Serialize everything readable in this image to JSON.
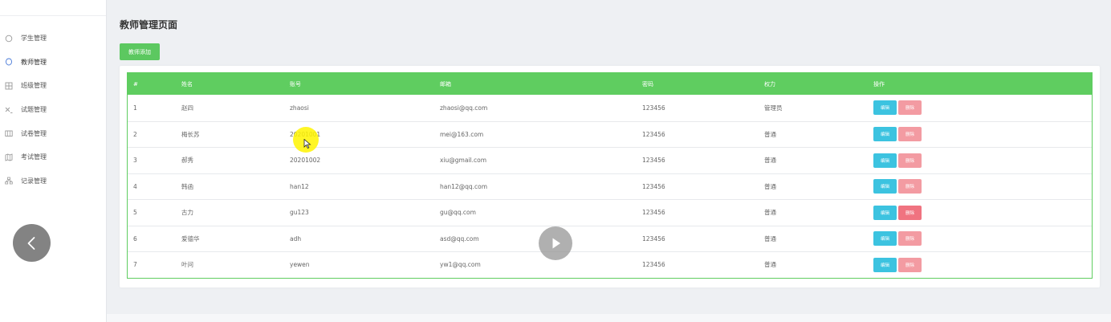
{
  "sidebar": {
    "items": [
      {
        "label": "学生管理",
        "icon": "student-icon"
      },
      {
        "label": "教师管理",
        "icon": "teacher-icon"
      },
      {
        "label": "班级管理",
        "icon": "class-icon"
      },
      {
        "label": "试题管理",
        "icon": "question-icon"
      },
      {
        "label": "试卷管理",
        "icon": "paper-icon"
      },
      {
        "label": "考试管理",
        "icon": "exam-icon"
      },
      {
        "label": "记录管理",
        "icon": "record-icon"
      }
    ],
    "active_index": 1
  },
  "page": {
    "title": "教师管理页面",
    "add_button": "教师添加"
  },
  "table": {
    "headers": [
      "#",
      "姓名",
      "账号",
      "邮箱",
      "密码",
      "权力",
      "操作"
    ],
    "rows": [
      {
        "id": "1",
        "name": "赵四",
        "account": "zhaosi",
        "email": "zhaosi@qq.com",
        "password": "123456",
        "role": "管理员"
      },
      {
        "id": "2",
        "name": "梅长苏",
        "account": "20201001",
        "email": "mei@163.com",
        "password": "123456",
        "role": "普通"
      },
      {
        "id": "3",
        "name": "郝秀",
        "account": "20201002",
        "email": "xiu@gmail.com",
        "password": "123456",
        "role": "普通"
      },
      {
        "id": "4",
        "name": "韩函",
        "account": "han12",
        "email": "han12@qq.com",
        "password": "123456",
        "role": "普通"
      },
      {
        "id": "5",
        "name": "古力",
        "account": "gu123",
        "email": "gu@qq.com",
        "password": "123456",
        "role": "普通"
      },
      {
        "id": "6",
        "name": "爱德华",
        "account": "adh",
        "email": "asd@qq.com",
        "password": "123456",
        "role": "普通"
      },
      {
        "id": "7",
        "name": "叶问",
        "account": "yewen",
        "email": "yw1@qq.com",
        "password": "123456",
        "role": "普通"
      }
    ],
    "edit_label": "编辑",
    "delete_label": "删除"
  },
  "colors": {
    "accent_green": "#5fcd60",
    "edit_blue": "#3cc3e0",
    "delete_pink": "#f39ba2"
  }
}
